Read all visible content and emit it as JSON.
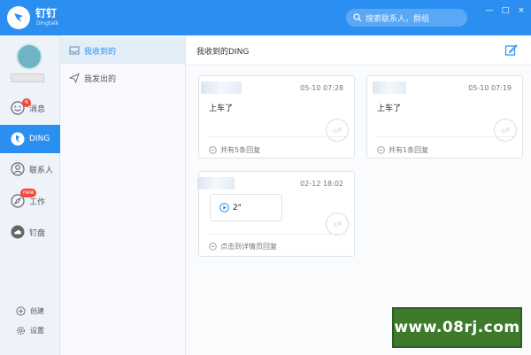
{
  "app": {
    "title": "钉钉",
    "subtitle": "Dingtalk"
  },
  "search": {
    "placeholder": "搜索联系人，群组"
  },
  "window": {
    "minimize": "—",
    "maximize": "□",
    "close": "×"
  },
  "nav": {
    "items": [
      {
        "label": "消息",
        "badge": "6",
        "icon": "smile-icon"
      },
      {
        "label": "DING",
        "icon": "ding-icon"
      },
      {
        "label": "联系人",
        "icon": "contact-icon"
      },
      {
        "label": "工作",
        "badge": "new",
        "icon": "compass-icon"
      },
      {
        "label": "钉盘",
        "icon": "cloud-icon"
      }
    ],
    "footer": [
      {
        "label": "创建",
        "icon": "plus-circle-icon"
      },
      {
        "label": "设置",
        "icon": "gear-icon"
      }
    ]
  },
  "submenu": {
    "items": [
      {
        "label": "我收到的",
        "icon": "inbox-icon"
      },
      {
        "label": "我发出的",
        "icon": "send-icon"
      }
    ]
  },
  "main": {
    "title": "我收到的DING",
    "cards": [
      {
        "time": "05-10 07:28",
        "text": "上车了",
        "reply": "共有5条回复",
        "stamp": "已读"
      },
      {
        "time": "05-10 07:19",
        "text": "上车了",
        "reply": "共有1条回复",
        "stamp": "已读"
      },
      {
        "time": "02-12 18:02",
        "voice": "2\"",
        "reply": "点击到详情页回复",
        "stamp": "已读"
      }
    ]
  },
  "watermark": {
    "text": "www.08rj.com"
  },
  "colors": {
    "accent": "#2b8ff2",
    "badge": "#f04a3c",
    "watermark": "#3d7a2c"
  }
}
